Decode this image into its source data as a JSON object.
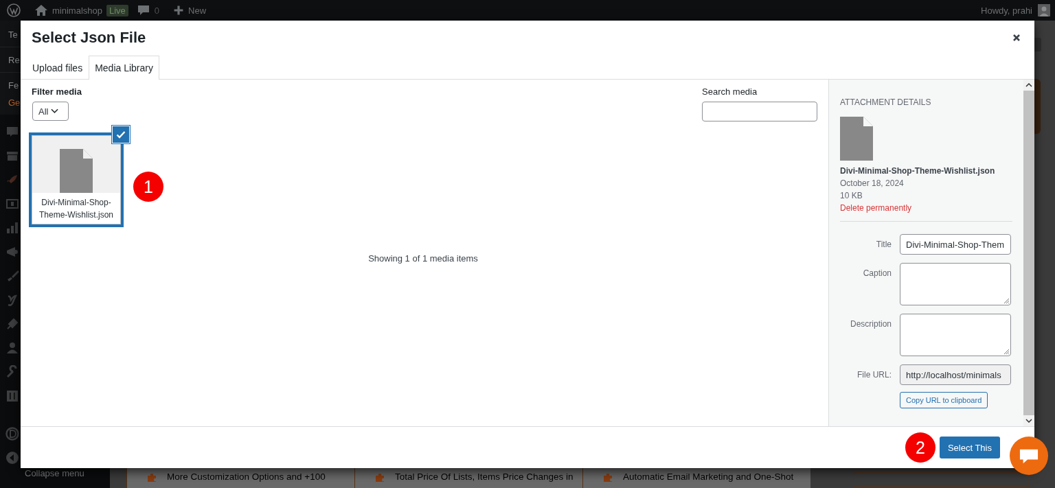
{
  "admin_bar": {
    "site_name": "minimalshop",
    "badge": "Live",
    "comments": "0",
    "new_label": "New",
    "greeting": "Howdy, prahi"
  },
  "admin_menu": {
    "items": [
      "Te",
      "Re",
      "Fe",
      "Ge"
    ],
    "collapse_label": "Collapse menu"
  },
  "page_features": [
    {
      "text": "More Customization Options and +100"
    },
    {
      "text": "Total Price Of Lists, Items Price Changes in"
    },
    {
      "text": "Automatic Email Marketing and One-Shot"
    }
  ],
  "modal": {
    "title": "Select Json File",
    "tabs": [
      {
        "label": "Upload files",
        "selected": false
      },
      {
        "label": "Media Library",
        "selected": true
      }
    ],
    "filter": {
      "label": "Filter media",
      "value": "All"
    },
    "search": {
      "label": "Search media"
    },
    "items": [
      {
        "filename": "Divi-Minimal-Shop-Theme-Wishlist.json",
        "selected": true,
        "annotation": "1"
      }
    ],
    "count_text": "Showing 1 of 1 media items",
    "details": {
      "heading": "ATTACHMENT DETAILS",
      "filename": "Divi-Minimal-Shop-Theme-Wishlist.json",
      "date": "October 18, 2024",
      "size": "10 KB",
      "delete_link": "Delete permanently",
      "fields": [
        {
          "label": "Title",
          "kind": "input",
          "value": "Divi-Minimal-Shop-Them"
        },
        {
          "label": "Caption",
          "kind": "textarea"
        },
        {
          "label": "Description",
          "kind": "textarea"
        },
        {
          "label": "File URL:",
          "kind": "readonly",
          "value": "http://localhost/minimals"
        }
      ],
      "copy_button": "Copy URL to clipboard"
    },
    "footer_annotation": "2",
    "primary_button": "Select This"
  }
}
